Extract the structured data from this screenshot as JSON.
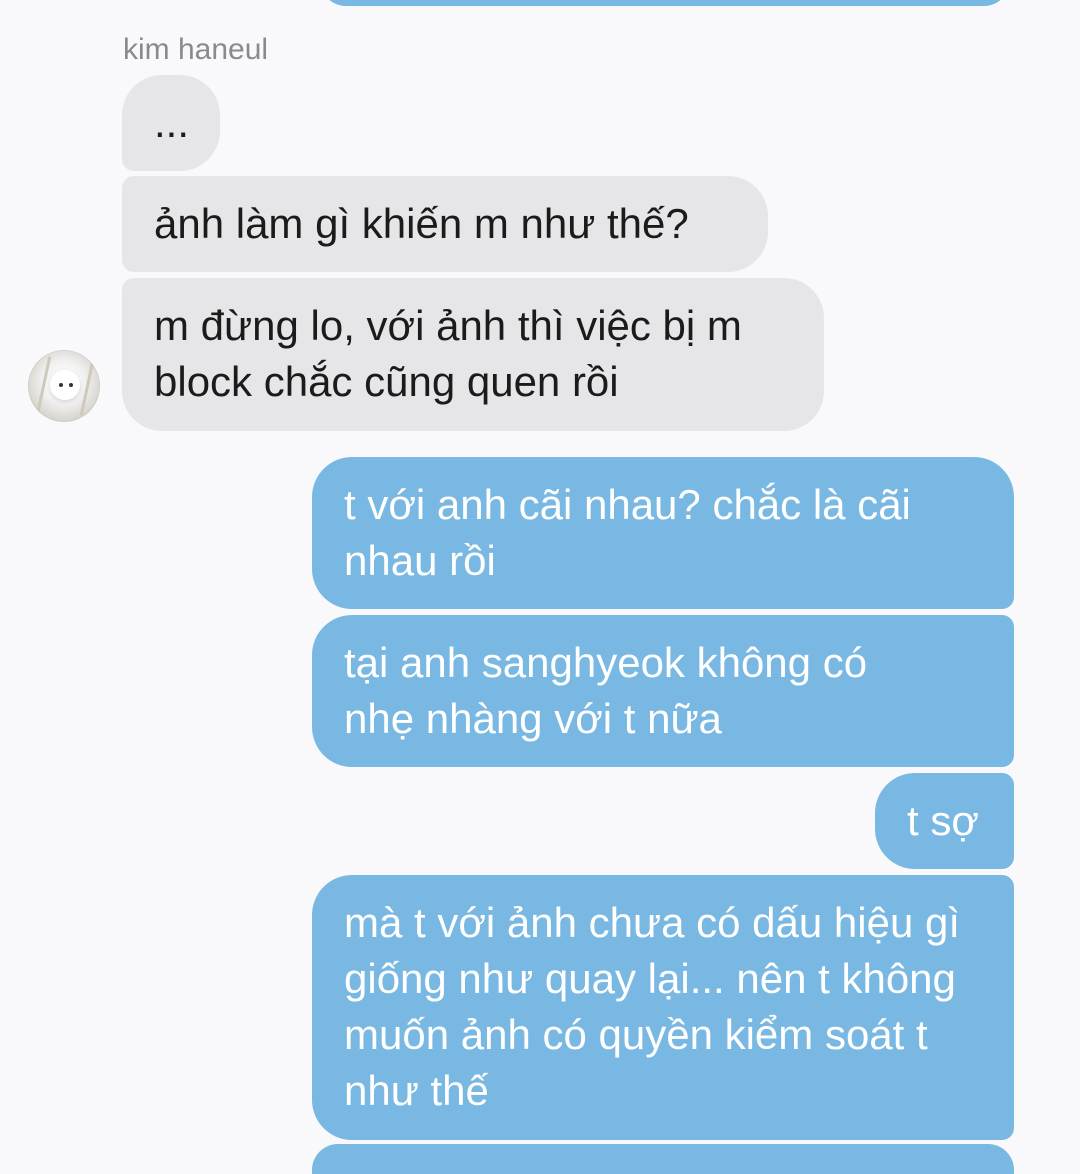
{
  "conversation": {
    "sender_name": "kim haneul",
    "incoming_messages": [
      "...",
      "ảnh làm gì khiến m như thế?",
      "m đừng lo, với ảnh thì việc bị m block chắc cũng quen rồi"
    ],
    "outgoing_messages": [
      "t với anh cãi nhau? chắc là cãi nhau rồi",
      "tại anh sanghyeok không có nhẹ nhàng với t nữa",
      "t sợ",
      "mà t với ảnh chưa có dấu hiệu gì giống như quay lại... nên t không muốn ảnh có quyền kiểm soát t như thế"
    ]
  },
  "colors": {
    "background": "#f9f9fb",
    "incoming_bubble": "#e6e6e8",
    "outgoing_bubble": "#79b8e3",
    "outgoing_text": "#ffffff",
    "incoming_text": "#1b1b1b",
    "sender_name": "#8a8a8e"
  }
}
